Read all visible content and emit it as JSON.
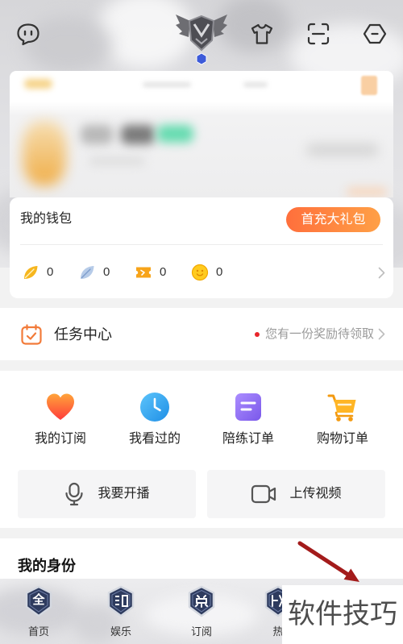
{
  "header": {
    "left_icon": "chat-icon",
    "center_emblem": "crest-emblem-icon",
    "right_icons": [
      "tshirt-icon",
      "scan-icon",
      "hexagon-menu-icon"
    ]
  },
  "wallet": {
    "title": "我的钱包",
    "promo_button": "首充大礼包",
    "currencies": [
      {
        "icon": "gold-leaf-icon",
        "value": "0"
      },
      {
        "icon": "blue-feather-icon",
        "value": "0"
      },
      {
        "icon": "ticket-icon",
        "value": "0"
      },
      {
        "icon": "smiley-coin-icon",
        "value": "0"
      }
    ],
    "more_icon": "chevron-right-icon"
  },
  "tasks": {
    "icon": "calendar-check-icon",
    "title": "任务中心",
    "notice": "您有一份奖励待领取"
  },
  "shortcuts": [
    {
      "icon": "heart-icon",
      "label": "我的订阅"
    },
    {
      "icon": "clock-icon",
      "label": "我看过的"
    },
    {
      "icon": "document-icon",
      "label": "陪练订单"
    },
    {
      "icon": "cart-icon",
      "label": "购物订单"
    }
  ],
  "actions": [
    {
      "icon": "microphone-icon",
      "label": "我要开播"
    },
    {
      "icon": "video-camera-icon",
      "label": "上传视频"
    }
  ],
  "identity": {
    "title": "我的身份"
  },
  "tabbar": [
    {
      "icon": "home-badge-icon",
      "glyph": "全",
      "label": "首页"
    },
    {
      "icon": "entertainment-badge-icon",
      "label": "娱乐"
    },
    {
      "icon": "subscribe-badge-icon",
      "label": "订阅"
    },
    {
      "icon": "hot-badge-icon",
      "label": "热"
    }
  ],
  "watermark": {
    "text": "软件技巧"
  },
  "colors": {
    "page_bg": "#f2f2f2",
    "promo_gradient_start": "#ff6f3c",
    "promo_gradient_end": "#ffa046",
    "notice_dot": "#e8262b",
    "annotation_arrow": "#a31b1b"
  }
}
